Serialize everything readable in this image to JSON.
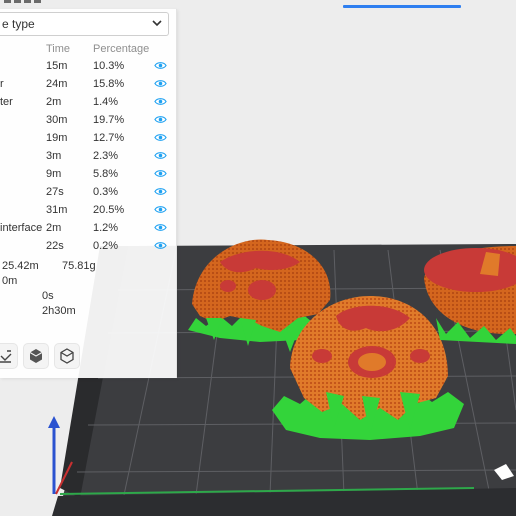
{
  "legend": {
    "dropdown_value": "e type",
    "headers": {
      "time": "Time",
      "percentage": "Percentage"
    },
    "rows": [
      {
        "name": "",
        "time": "15m",
        "pct": "10.3%"
      },
      {
        "name": "r",
        "time": "24m",
        "pct": "15.8%"
      },
      {
        "name": "ter",
        "time": "2m",
        "pct": "1.4%"
      },
      {
        "name": "",
        "time": "30m",
        "pct": "19.7%"
      },
      {
        "name": "",
        "time": "19m",
        "pct": "12.7%"
      },
      {
        "name": "",
        "time": "3m",
        "pct": "2.3%"
      },
      {
        "name": "",
        "time": "9m",
        "pct": "5.8%"
      },
      {
        "name": "",
        "time": "27s",
        "pct": "0.3%"
      },
      {
        "name": "",
        "time": "31m",
        "pct": "20.5%"
      },
      {
        "name": "interface",
        "time": "2m",
        "pct": "1.2%"
      },
      {
        "name": "",
        "time": "22s",
        "pct": "0.2%"
      }
    ],
    "summary": {
      "length": "25.42m",
      "weight": "75.81g",
      "length_cont": "0m",
      "prepare": "0s",
      "total": "2h30m"
    }
  },
  "colors": {
    "accent": "#2f7ff0",
    "model_orange": "#d4661e",
    "model_red": "#c83a37",
    "support_green": "#33d43a",
    "eye_icon": "#1da1f2"
  },
  "icons": [
    "chevron-down-icon",
    "eye-icon",
    "layers-icon",
    "cube-solid-icon",
    "cube-outline-icon"
  ]
}
